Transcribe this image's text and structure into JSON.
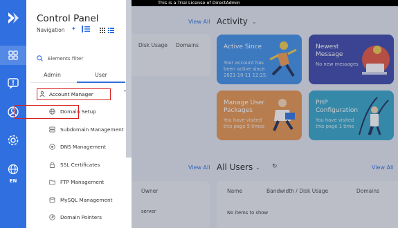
{
  "banner": "This is a Trial License of DirectAdmin",
  "sidebar": {
    "title": "Control Panel",
    "navigation_label": "Navigation",
    "search_placeholder": "Elements filter",
    "tabs": [
      {
        "label": "Admin"
      },
      {
        "label": "User"
      }
    ],
    "active_tab": "User",
    "account_manager": "Account Manager",
    "items": [
      {
        "label": "Domain Setup",
        "icon": "globe-icon"
      },
      {
        "label": "Subdomain Management",
        "icon": "server-icon"
      },
      {
        "label": "DNS Management",
        "icon": "dns-icon"
      },
      {
        "label": "SSL Certificates",
        "icon": "lock-icon"
      },
      {
        "label": "FTP Management",
        "icon": "folder-icon"
      },
      {
        "label": "MySQL Management",
        "icon": "database-icon"
      },
      {
        "label": "Domain Pointers",
        "icon": "pointer-icon"
      }
    ],
    "language": "EN"
  },
  "dashboard": {
    "left_card_headers": [
      "Disk Usage",
      "Domains"
    ],
    "activity": {
      "title": "Activity",
      "view_all": "View All",
      "tiles": [
        {
          "title": "Active Since",
          "text": "Your account has been active since 2021-10-11 12:25."
        },
        {
          "title": "Newest Message",
          "text": "No new messages"
        },
        {
          "title": "Manage User Packages",
          "text": "You have visited this page 5 times"
        },
        {
          "title": "PHP Configuration",
          "text": "You have visited this page 1 time"
        }
      ]
    },
    "all_users": {
      "title": "All Users",
      "view_all": "View All",
      "left_view_all": "View All",
      "left_headers": [
        "Owner"
      ],
      "left_value": "server",
      "headers": [
        "Name",
        "Bandwidth / Disk Usage",
        "Domains"
      ],
      "empty": "No items to show"
    },
    "top_view_all": "View All"
  },
  "colors": {
    "accent": "#2f6fe0",
    "highlight_box": "#d92020"
  }
}
